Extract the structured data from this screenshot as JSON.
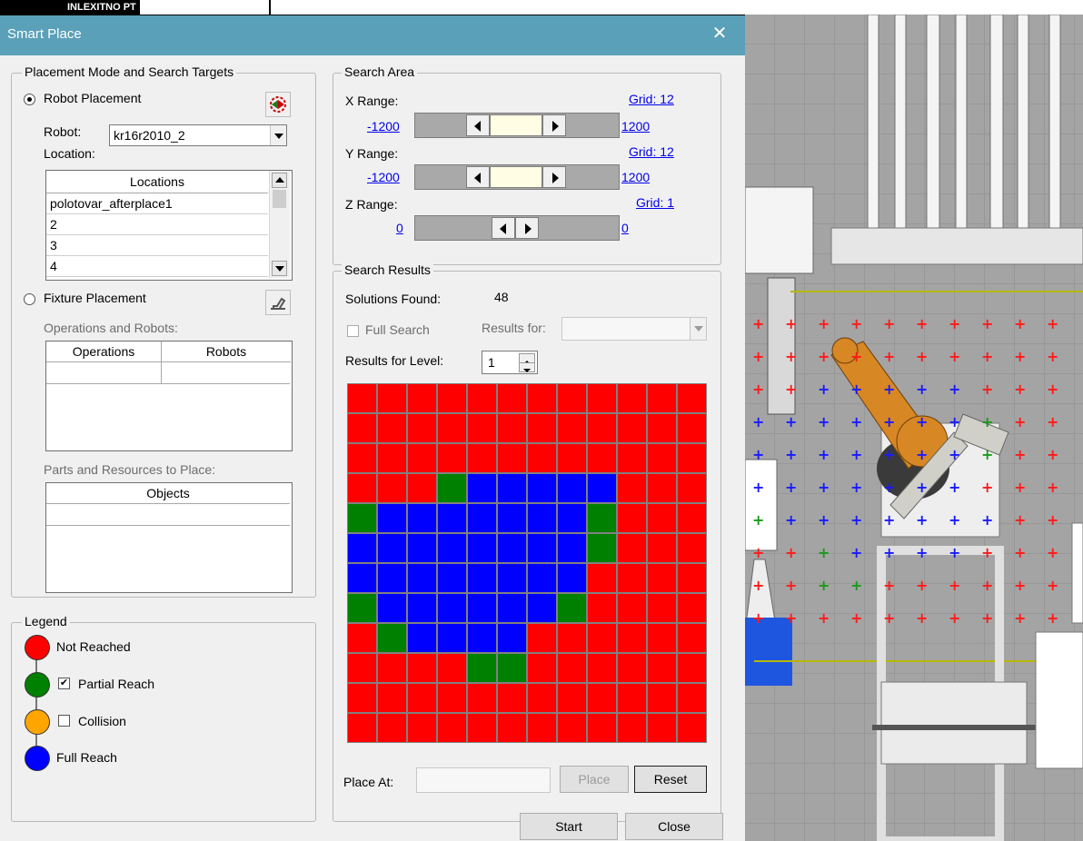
{
  "title": "Smart Place",
  "top_strip_label": "INLEXITNO PT",
  "placement_group": {
    "title": "Placement Mode and Search Targets",
    "robot_placement_label": "Robot Placement",
    "robot_label": "Robot:",
    "robot_value": "kr16r2010_2",
    "location_label": "Location:",
    "locations_header": "Locations",
    "locations": [
      "polotovar_afterplace1",
      "2",
      "3",
      "4"
    ],
    "fixture_placement_label": "Fixture Placement",
    "operations_robots_label": "Operations and Robots:",
    "operations_header": "Operations",
    "robots_header": "Robots",
    "parts_label": "Parts and Resources to Place:",
    "objects_header": "Objects"
  },
  "search_area": {
    "title": "Search Area",
    "x_label": "X Range:",
    "x_grid": "Grid: 12",
    "x_min": "-1200",
    "x_max": "1200",
    "y_label": "Y Range:",
    "y_grid": "Grid: 12",
    "y_min": "-1200",
    "y_max": "1200",
    "z_label": "Z Range:",
    "z_grid": "Grid: 1",
    "z_min": "0",
    "z_max": "0"
  },
  "search_results": {
    "title": "Search Results",
    "solutions_label": "Solutions Found:",
    "solutions_value": "48",
    "full_search_label": "Full Search",
    "results_for_label": "Results for:",
    "results_for_value": "",
    "level_label": "Results for Level:",
    "level_value": "1",
    "grid_colors": {
      "R": "#ff0000",
      "G": "#008000",
      "B": "#0000ff"
    },
    "grid_cells": [
      "RRRRRRRRRRRR",
      "RRRRRRRRRRRR",
      "RRRRRRRRRRRR",
      "RRRGBBBBBRRR",
      "GBBBBBBBGRRR",
      "BBBBBBBBGRRR",
      "BBBBBBBBRRRR",
      "GBBBBBBGRRRR",
      "RGBBBBRRRRRR",
      "RRRRGGRRRRRR",
      "RRRRRRRRRRRR",
      "RRRRRRRRRRRR"
    ],
    "place_at_label": "Place At:",
    "place_at_value": "",
    "place_button": "Place",
    "reset_button": "Reset"
  },
  "legend": {
    "title": "Legend",
    "items": [
      {
        "label": "Not Reached",
        "color": "#ff0000",
        "checkbox": false
      },
      {
        "label": "Partial Reach",
        "color": "#008000",
        "checkbox": true,
        "checked": true
      },
      {
        "label": "Collision",
        "color": "#ffa500",
        "checkbox": true,
        "checked": false
      },
      {
        "label": "Full Reach",
        "color": "#0000ff",
        "checkbox": false
      }
    ]
  },
  "footer": {
    "start_button": "Start",
    "close_button": "Close"
  }
}
